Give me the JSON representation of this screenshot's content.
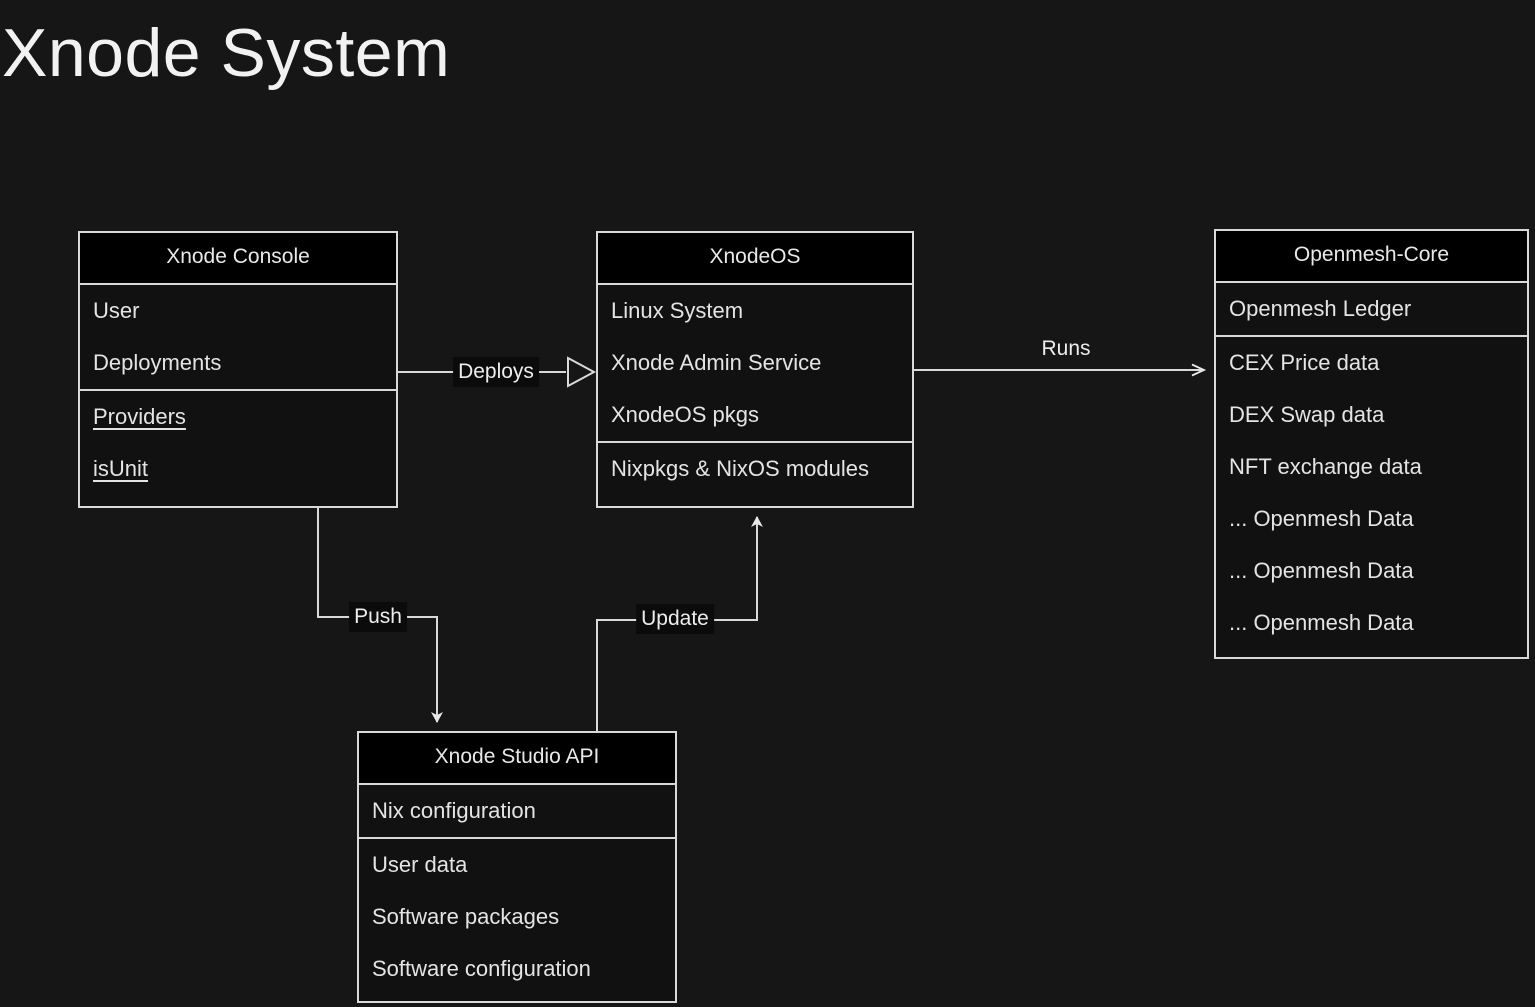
{
  "page": {
    "title": "Xnode System",
    "background_color": "#161616",
    "line_color": "#d9d9d9",
    "text_color": "#e8e8e8",
    "title_bar_color": "#000000",
    "box_fill_color": "#111111"
  },
  "boxes": [
    {
      "id": "xnode-console",
      "title": "Xnode Console",
      "sections": [
        {
          "rows": [
            {
              "text": "User",
              "underline": false
            },
            {
              "text": "Deployments",
              "underline": false
            }
          ]
        },
        {
          "rows": [
            {
              "text": "Providers",
              "underline": true
            },
            {
              "text": "isUnit",
              "underline": true
            }
          ]
        }
      ]
    },
    {
      "id": "xnodeos",
      "title": "XnodeOS",
      "sections": [
        {
          "rows": [
            {
              "text": "Linux System",
              "underline": false
            },
            {
              "text": "Xnode Admin Service",
              "underline": false
            },
            {
              "text": "XnodeOS pkgs",
              "underline": false
            }
          ]
        },
        {
          "rows": [
            {
              "text": "Nixpkgs & NixOS modules",
              "underline": false
            }
          ]
        }
      ]
    },
    {
      "id": "openmesh-core",
      "title": "Openmesh-Core",
      "sections": [
        {
          "rows": [
            {
              "text": "Openmesh Ledger",
              "underline": false
            }
          ]
        },
        {
          "rows": [
            {
              "text": "CEX Price data",
              "underline": false
            },
            {
              "text": "DEX Swap data",
              "underline": false
            },
            {
              "text": "NFT exchange data",
              "underline": false
            },
            {
              "text": "... Openmesh Data",
              "underline": false
            },
            {
              "text": "... Openmesh Data",
              "underline": false
            },
            {
              "text": "... Openmesh Data",
              "underline": false
            }
          ]
        }
      ]
    },
    {
      "id": "xnode-studio-api",
      "title": "Xnode Studio API",
      "sections": [
        {
          "rows": [
            {
              "text": "Nix configuration",
              "underline": false
            }
          ]
        },
        {
          "rows": [
            {
              "text": "User data",
              "underline": false
            },
            {
              "text": "Software packages",
              "underline": false
            },
            {
              "text": "Software configuration",
              "underline": false
            }
          ]
        }
      ]
    }
  ],
  "edges": [
    {
      "id": "deploys",
      "label": "Deploys",
      "from": "xnode-console",
      "to": "xnodeos",
      "arrow": "hollow-triangle"
    },
    {
      "id": "runs",
      "label": "Runs",
      "from": "xnodeos",
      "to": "openmesh-core",
      "arrow": "open"
    },
    {
      "id": "push",
      "label": "Push",
      "from": "xnode-console",
      "to": "xnode-studio-api",
      "arrow": "solid"
    },
    {
      "id": "update",
      "label": "Update",
      "from": "xnode-studio-api",
      "to": "xnodeos",
      "arrow": "solid"
    }
  ]
}
